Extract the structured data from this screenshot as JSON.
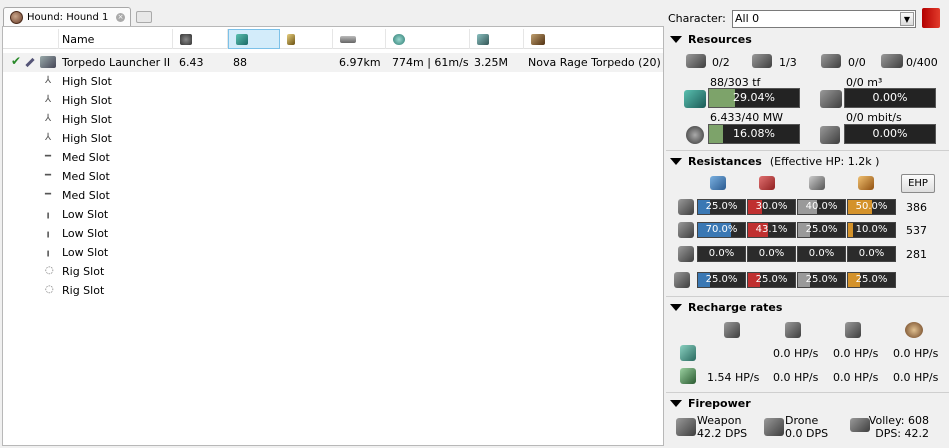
{
  "tab": {
    "title": "Hound: Hound 1"
  },
  "columns": {
    "name": "Name"
  },
  "module": {
    "name": "Torpedo Launcher II",
    "cpu": "6.43",
    "power": "88",
    "optimal": "6.97km",
    "explosion": "774m | 61m/s",
    "price": "3.25M",
    "charge": "Nova Rage Torpedo (20)"
  },
  "slots": [
    "High Slot",
    "High Slot",
    "High Slot",
    "High Slot",
    "Med Slot",
    "Med Slot",
    "Med Slot",
    "Low Slot",
    "Low Slot",
    "Low Slot",
    "Rig Slot",
    "Rig Slot"
  ],
  "character": {
    "label": "Character:",
    "value": "All 0"
  },
  "resources": {
    "title": "Resources",
    "hardpoints": {
      "turret": "0/2",
      "launcher": "1/3",
      "calibration": "0/0",
      "drones": "0/400"
    },
    "cpu": {
      "label": "88/303 tf",
      "pct": "29.04%",
      "frac": 0.2904
    },
    "dronebay": {
      "label": "0/0 m³",
      "pct": "0.00%",
      "frac": 0
    },
    "power": {
      "label": "6.433/40 MW",
      "pct": "16.08%",
      "frac": 0.1608
    },
    "bandwidth": {
      "label": "0/0 mbit/s",
      "pct": "0.00%",
      "frac": 0
    }
  },
  "resistances": {
    "title": "Resistances",
    "ehp_text": "(Effective HP: 1.2k )",
    "ehp_button": "EHP",
    "colors": {
      "em": "#3a78b4",
      "thermal": "#c03030",
      "kinetic": "#9a9a9a",
      "explosive": "#d4922a"
    },
    "rows": [
      {
        "name": "shield",
        "values": [
          "25.0%",
          "30.0%",
          "40.0%",
          "50.0%"
        ],
        "fracs": [
          0.25,
          0.3,
          0.4,
          0.5
        ],
        "hp": "386"
      },
      {
        "name": "armor",
        "values": [
          "70.0%",
          "43.1%",
          "25.0%",
          "10.0%"
        ],
        "fracs": [
          0.7,
          0.431,
          0.25,
          0.1
        ],
        "hp": "537"
      },
      {
        "name": "hull",
        "values": [
          "0.0%",
          "0.0%",
          "0.0%",
          "0.0%"
        ],
        "fracs": [
          0,
          0,
          0,
          0
        ],
        "hp": "281"
      },
      {
        "name": "damage-pattern",
        "values": [
          "25.0%",
          "25.0%",
          "25.0%",
          "25.0%"
        ],
        "fracs": [
          0.25,
          0.25,
          0.25,
          0.25
        ],
        "hp": ""
      }
    ]
  },
  "recharge": {
    "title": "Recharge rates",
    "row1": [
      "0.0 HP/s",
      "0.0 HP/s",
      "0.0 HP/s"
    ],
    "row2": [
      "1.54 HP/s",
      "0.0 HP/s",
      "0.0 HP/s",
      "0.0 HP/s"
    ]
  },
  "firepower": {
    "title": "Firepower",
    "weapon_label": "Weapon",
    "weapon_dps": "42.2 DPS",
    "drone_label": "Drone",
    "drone_dps": "0.0 DPS",
    "volley": "Volley: 608",
    "dps": "DPS: 42.2"
  }
}
